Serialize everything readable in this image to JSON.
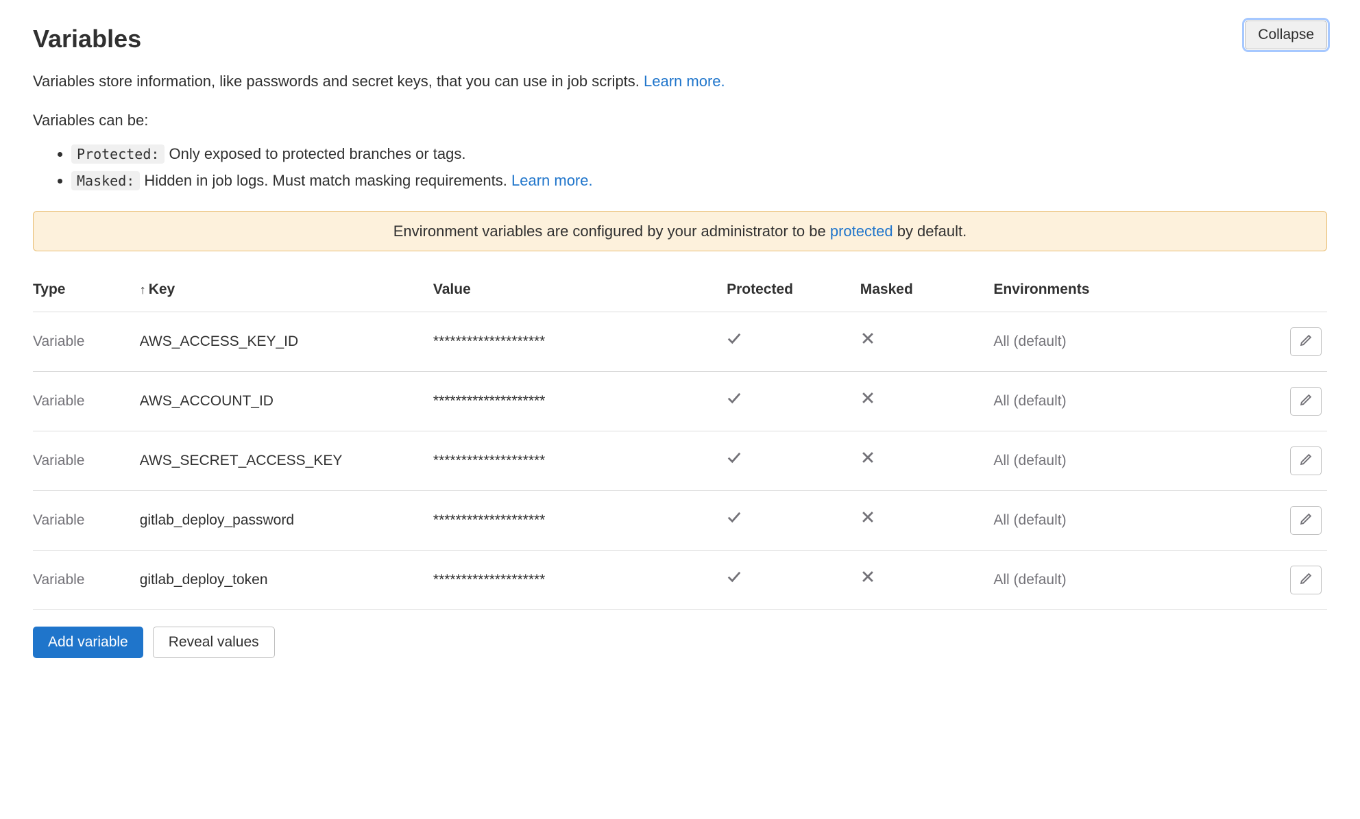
{
  "header": {
    "title": "Variables",
    "collapse_label": "Collapse"
  },
  "description": {
    "text": "Variables store information, like passwords and secret keys, that you can use in job scripts. ",
    "learn_more": "Learn more."
  },
  "types_intro": "Variables can be:",
  "types": {
    "protected": {
      "label": "Protected:",
      "text": " Only exposed to protected branches or tags."
    },
    "masked": {
      "label": "Masked:",
      "text": " Hidden in job logs. Must match masking requirements. ",
      "learn_more": "Learn more."
    }
  },
  "banner": {
    "prefix": "Environment variables are configured by your administrator to be ",
    "link": "protected",
    "suffix": " by default."
  },
  "table": {
    "headers": {
      "type": "Type",
      "key": "Key",
      "value": "Value",
      "protected": "Protected",
      "masked": "Masked",
      "environments": "Environments"
    },
    "sort_indicator": "↑",
    "rows": [
      {
        "type": "Variable",
        "key": "AWS_ACCESS_KEY_ID",
        "value": "********************",
        "protected": true,
        "masked": false,
        "environments": "All (default)"
      },
      {
        "type": "Variable",
        "key": "AWS_ACCOUNT_ID",
        "value": "********************",
        "protected": true,
        "masked": false,
        "environments": "All (default)"
      },
      {
        "type": "Variable",
        "key": "AWS_SECRET_ACCESS_KEY",
        "value": "********************",
        "protected": true,
        "masked": false,
        "environments": "All (default)"
      },
      {
        "type": "Variable",
        "key": "gitlab_deploy_password",
        "value": "********************",
        "protected": true,
        "masked": false,
        "environments": "All (default)"
      },
      {
        "type": "Variable",
        "key": "gitlab_deploy_token",
        "value": "********************",
        "protected": true,
        "masked": false,
        "environments": "All (default)"
      }
    ]
  },
  "actions": {
    "add_variable": "Add variable",
    "reveal_values": "Reveal values"
  }
}
